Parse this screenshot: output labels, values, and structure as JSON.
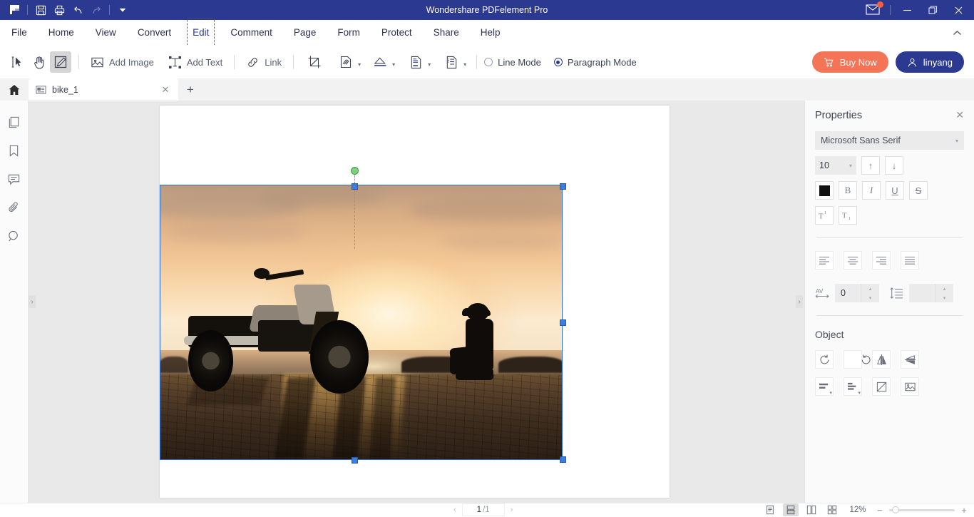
{
  "window": {
    "title": "Wondershare PDFelement Pro",
    "quick_access": [
      "logo-icon",
      "save-icon",
      "print-icon",
      "undo-icon",
      "redo-icon",
      "customize-dropdown-icon"
    ],
    "controls": {
      "mail": "mail-icon",
      "minimize": "—",
      "maximize": "❐",
      "close": "✕"
    },
    "accent_blue": "#2b3990"
  },
  "menubar": {
    "items": [
      {
        "label": "File",
        "active": false
      },
      {
        "label": "Home",
        "active": false
      },
      {
        "label": "View",
        "active": false
      },
      {
        "label": "Convert",
        "active": false
      },
      {
        "label": "Edit",
        "active": true
      },
      {
        "label": "Comment",
        "active": false
      },
      {
        "label": "Page",
        "active": false
      },
      {
        "label": "Form",
        "active": false
      },
      {
        "label": "Protect",
        "active": false
      },
      {
        "label": "Share",
        "active": false
      },
      {
        "label": "Help",
        "active": false
      }
    ],
    "collapse": "chevron-up-icon"
  },
  "toolbar": {
    "select_tool": "select-cursor-icon",
    "hand_tool": "hand-icon",
    "edit_tool": "edit-text-icon",
    "add_image": "Add Image",
    "add_text": "Add Text",
    "link": "Link",
    "crop": "crop-icon",
    "watermark": "watermark-icon",
    "background": "background-icon",
    "header_footer": "header-footer-icon",
    "bates": "bates-numbering-icon",
    "line_mode": "Line Mode",
    "paragraph_mode": "Paragraph Mode",
    "mode_selected": "Paragraph Mode",
    "buy_now": "Buy Now",
    "account": "linyang",
    "buy_color": "#f47458",
    "account_color": "#2b3990"
  },
  "tabbar": {
    "home": "home-icon",
    "tabs": [
      {
        "label": "bike_1",
        "icon": "pdf-file-icon",
        "close": "✕"
      }
    ],
    "new_tab": "+"
  },
  "leftrail": {
    "items": [
      {
        "name": "pages-panel",
        "icon": "pages-icon"
      },
      {
        "name": "bookmarks-panel",
        "icon": "bookmark-icon"
      },
      {
        "name": "comments-panel",
        "icon": "comment-icon"
      },
      {
        "name": "attachments-panel",
        "icon": "paperclip-icon"
      },
      {
        "name": "search-panel",
        "icon": "search-icon"
      }
    ]
  },
  "document": {
    "page_background": "#ffffff",
    "canvas_background": "#e9e9e9",
    "image_alt": "Motorcycle parked on a cobblestone promenade at sunset with a man sitting by the sea",
    "selection": {
      "border_color": "#2d6fd4",
      "handle_color": "#3a7ee0",
      "rotate_handle_color": "#7ed07e"
    }
  },
  "properties": {
    "title": "Properties",
    "close": "✕",
    "font_family": "Microsoft Sans Serif",
    "font_size": "10",
    "increase_size": "↑",
    "decrease_size": "↓",
    "text_color": "#111111",
    "bold": "B",
    "italic": "I",
    "underline": "U",
    "strikethrough": "S",
    "superscript": "superscript-icon",
    "subscript": "subscript-icon",
    "align_left": "align-left-icon",
    "align_center": "align-center-icon",
    "align_right": "align-right-icon",
    "align_justify": "align-justify-icon",
    "char_spacing_label": "AV",
    "char_spacing_value": "0",
    "line_spacing_label": "line-spacing-icon",
    "line_spacing_value": "",
    "object_section": "Object",
    "object_tools": [
      {
        "name": "rotate-left-button",
        "icon": "rotate-ccw-icon"
      },
      {
        "name": "rotate-right-button",
        "icon": "rotate-cw-icon"
      },
      {
        "name": "flip-horizontal-button",
        "icon": "flip-horizontal-icon"
      },
      {
        "name": "flip-vertical-button",
        "icon": "flip-vertical-icon"
      },
      {
        "name": "align-objects-button",
        "icon": "align-objects-icon"
      },
      {
        "name": "distribute-objects-button",
        "icon": "distribute-objects-icon"
      },
      {
        "name": "crop-image-button",
        "icon": "crop-icon"
      },
      {
        "name": "replace-image-button",
        "icon": "image-icon"
      }
    ]
  },
  "statusbar": {
    "prev_page": "‹",
    "next_page": "›",
    "current_page": "1",
    "page_separator": "/1",
    "views": [
      {
        "name": "single-page-view",
        "icon": "single-page-icon",
        "active": false
      },
      {
        "name": "continuous-view",
        "icon": "continuous-page-icon",
        "active": true
      },
      {
        "name": "facing-view",
        "icon": "two-page-icon",
        "active": false
      },
      {
        "name": "thumbnail-view",
        "icon": "grid-view-icon",
        "active": false
      }
    ],
    "zoom_value": "12%",
    "zoom_out": "−",
    "zoom_in": "+"
  }
}
